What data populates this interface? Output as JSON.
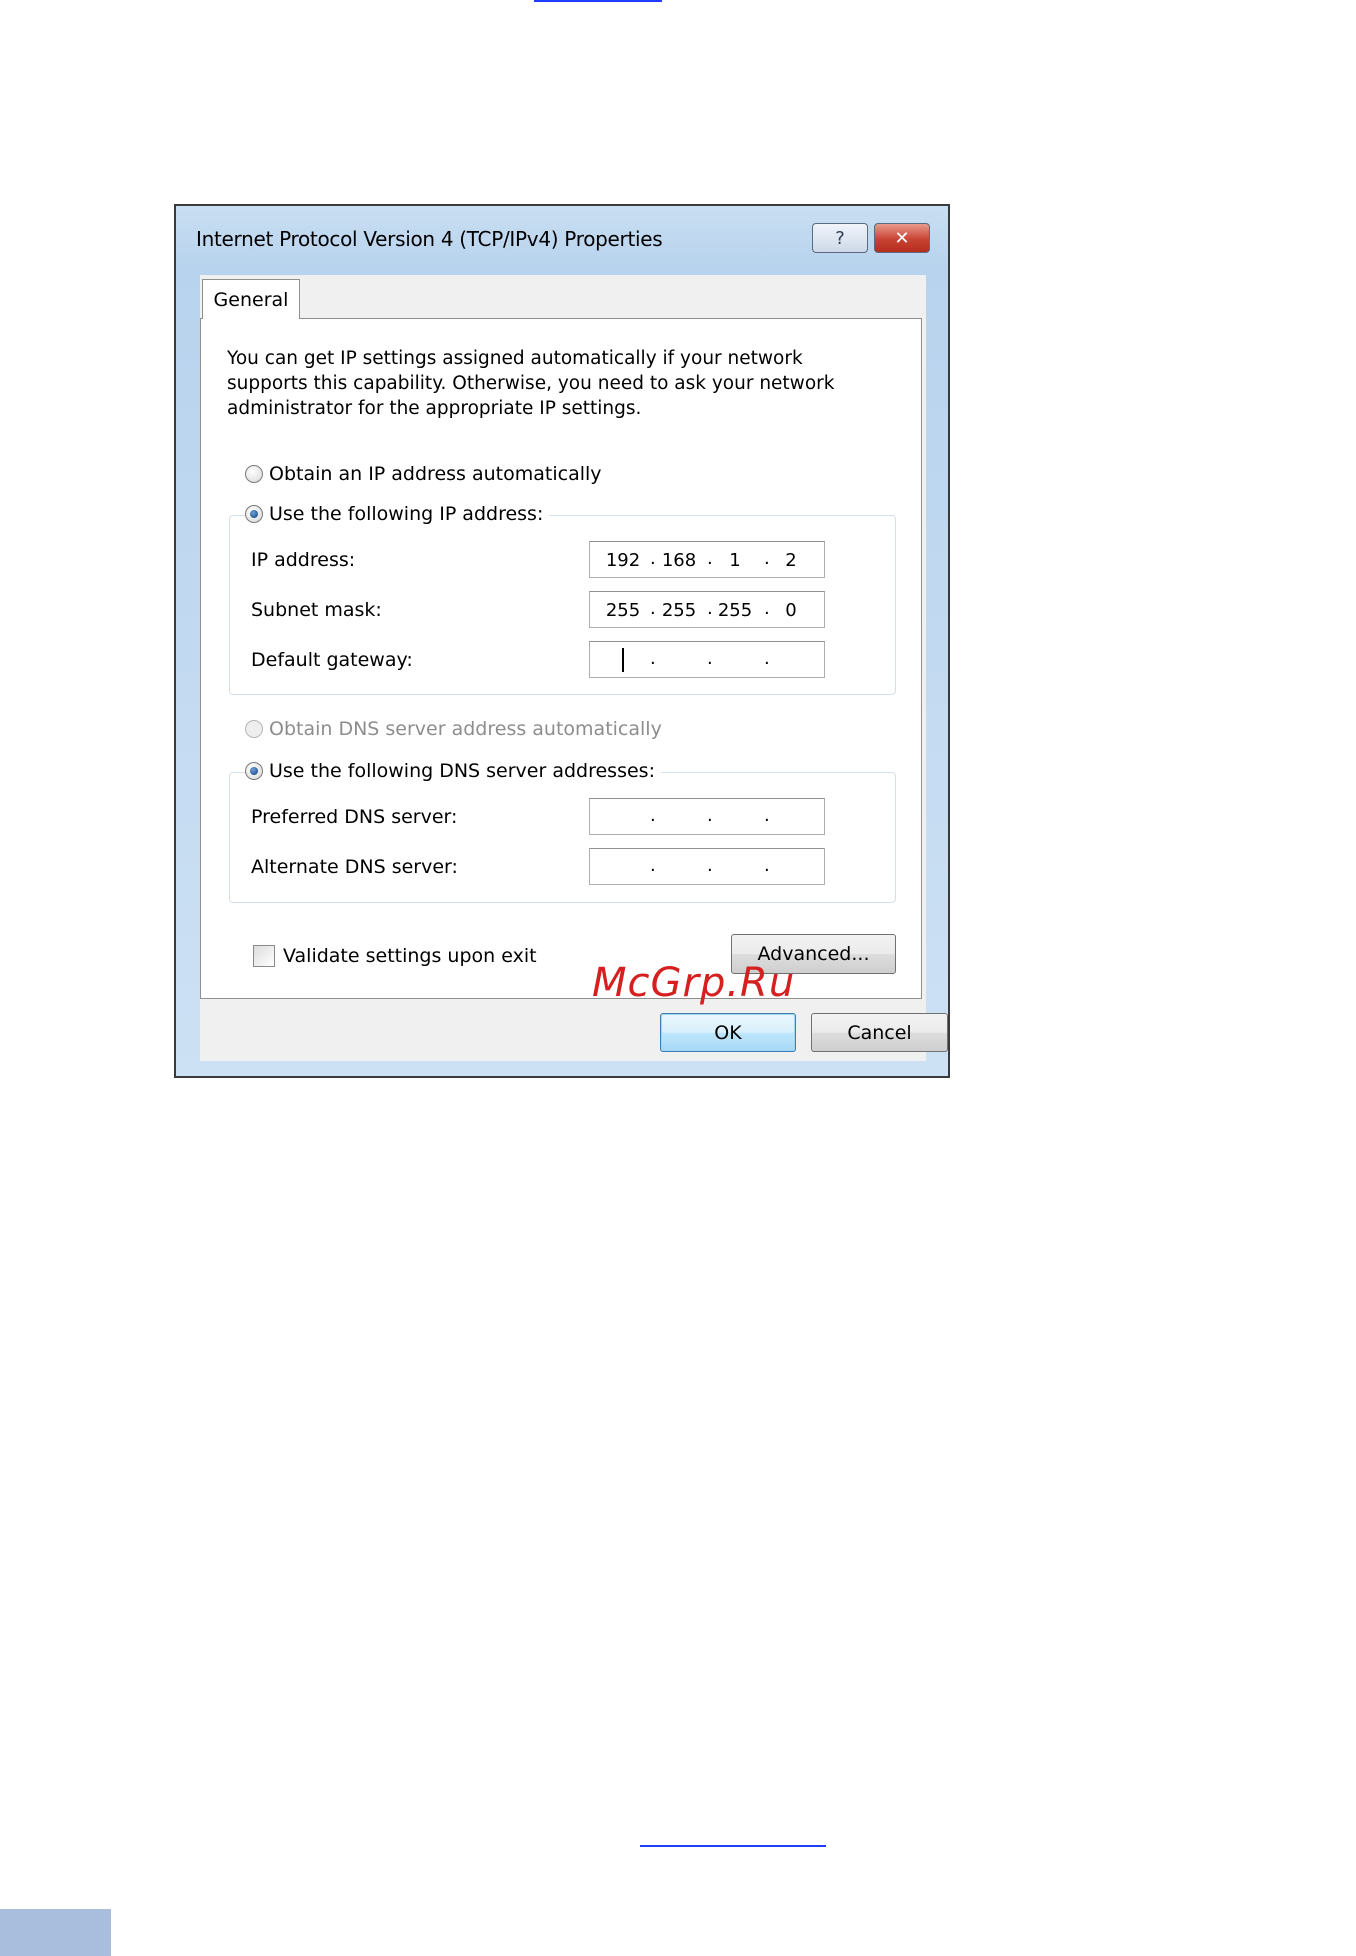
{
  "dialog": {
    "title": "Internet Protocol Version 4 (TCP/IPv4) Properties",
    "help_icon": "?",
    "close_icon": "✕",
    "tab_label": "General",
    "description": "You can get IP settings assigned automatically if your network supports this capability. Otherwise, you need to ask your network administrator for the appropriate IP settings.",
    "ip_options": {
      "auto_label": "Obtain an IP address automatically",
      "manual_label": "Use the following IP address:",
      "selected": "manual"
    },
    "ip_fields": {
      "ip_address": {
        "label": "IP address:",
        "octets": [
          "192",
          "168",
          "1",
          "2"
        ]
      },
      "subnet_mask": {
        "label": "Subnet mask:",
        "octets": [
          "255",
          "255",
          "255",
          "0"
        ]
      },
      "default_gateway": {
        "label": "Default gateway:",
        "octets": [
          "",
          "",
          "",
          ""
        ],
        "focused": true
      }
    },
    "dns_options": {
      "auto_label": "Obtain DNS server address automatically",
      "auto_disabled": true,
      "manual_label": "Use the following DNS server addresses:",
      "selected": "manual"
    },
    "dns_fields": {
      "preferred": {
        "label": "Preferred DNS server:",
        "octets": [
          "",
          "",
          "",
          ""
        ]
      },
      "alternate": {
        "label": "Alternate DNS server:",
        "octets": [
          "",
          "",
          "",
          ""
        ]
      }
    },
    "validate_label": "Validate settings upon exit",
    "validate_checked": false,
    "advanced_label": "Advanced...",
    "ok_label": "OK",
    "cancel_label": "Cancel"
  },
  "watermark": "McGrp.Ru",
  "colors": {
    "link_underline": "#1f3cff",
    "page_corner": "#a8bedc",
    "watermark": "#d62020"
  }
}
